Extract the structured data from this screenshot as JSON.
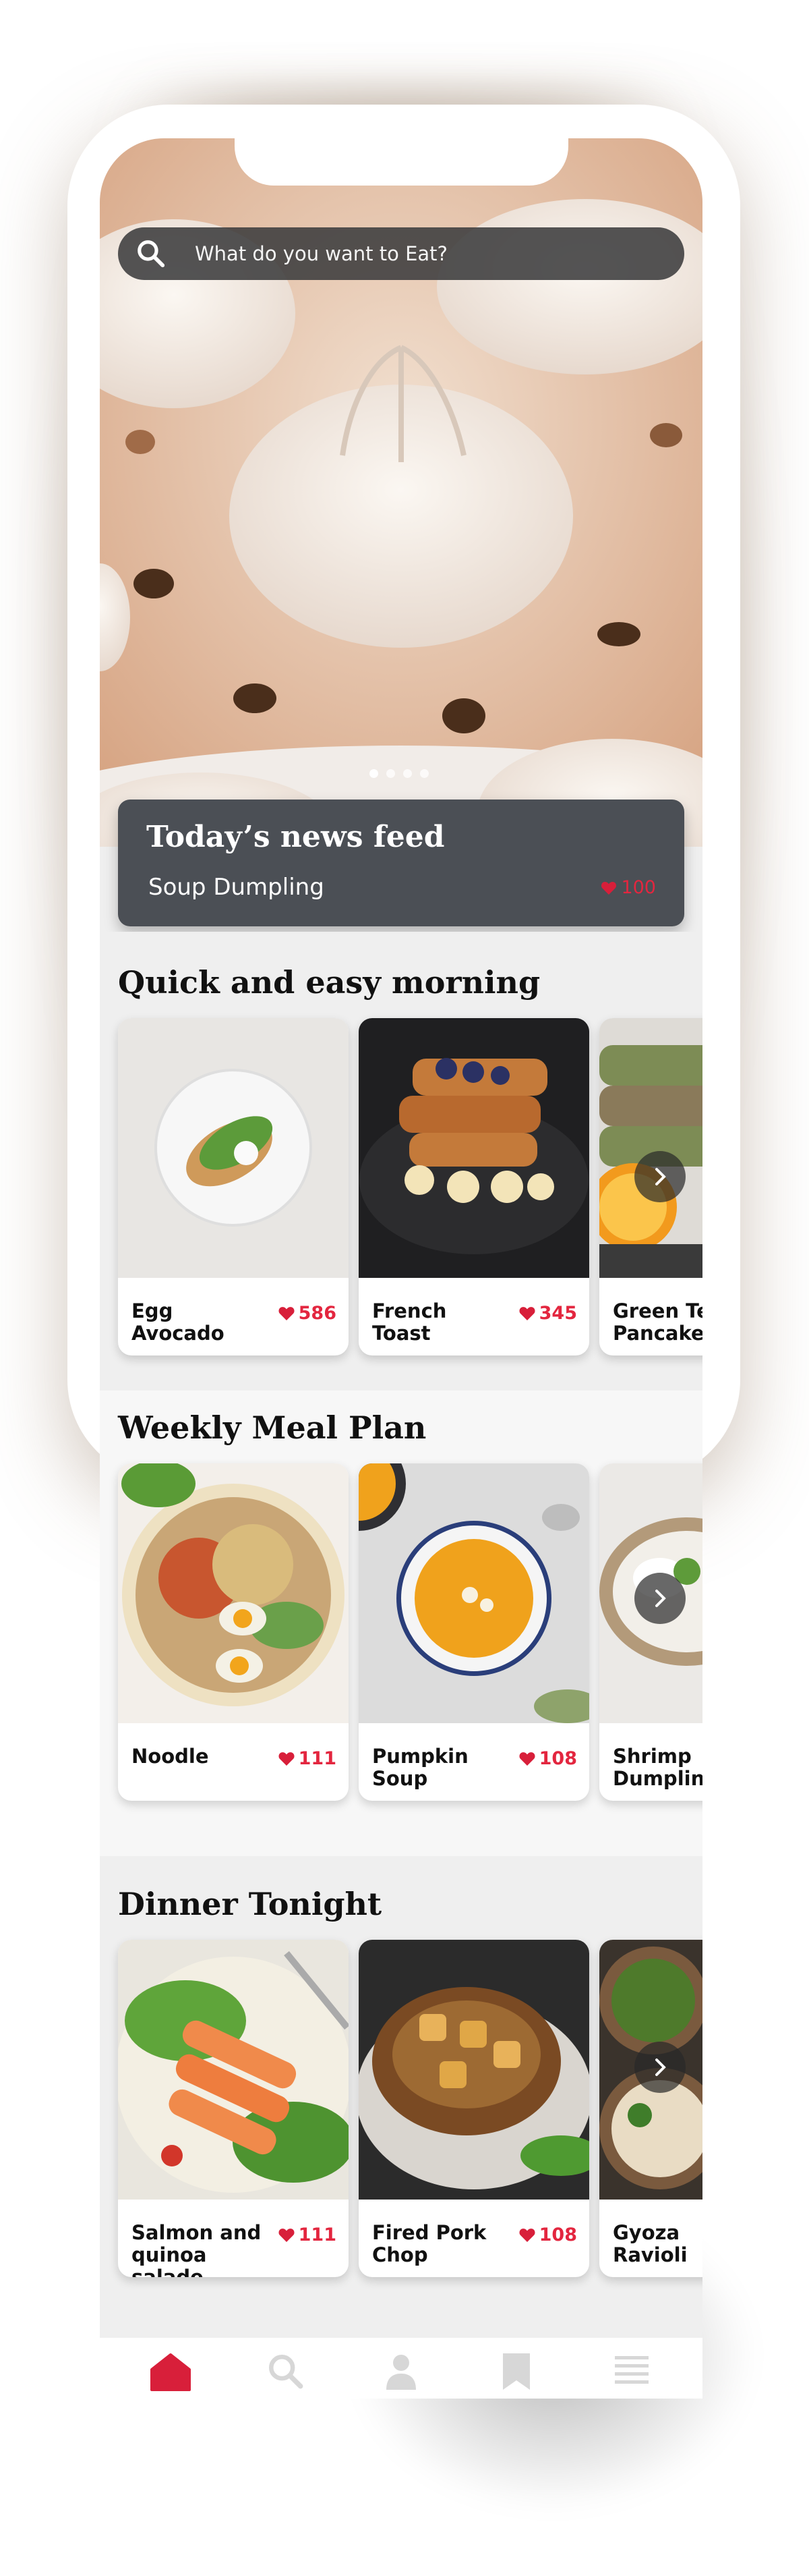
{
  "search": {
    "placeholder": "What do you want to Eat?"
  },
  "hero": {
    "dots": 4,
    "active_dot": 0
  },
  "news": {
    "title": "Today’s news feed",
    "subtitle": "Soup Dumpling",
    "likes": "100"
  },
  "sections": [
    {
      "title": "Quick and easy morning",
      "cards": [
        {
          "name": "Egg Avocado",
          "likes": "586"
        },
        {
          "name": "French Toast",
          "likes": "345"
        },
        {
          "name": "Green Tea Pancake",
          "likes": ""
        }
      ]
    },
    {
      "title": "Weekly Meal Plan",
      "cards": [
        {
          "name": "Noodle",
          "likes": "111"
        },
        {
          "name": "Pumpkin Soup",
          "likes": "108"
        },
        {
          "name": "Shrimp Dumpling",
          "likes": ""
        }
      ]
    },
    {
      "title": "Dinner Tonight",
      "cards": [
        {
          "name": "Salmon and quinoa salade",
          "likes": "111"
        },
        {
          "name": "Fired Pork Chop",
          "likes": "108"
        },
        {
          "name": "Gyoza Ravioli",
          "likes": ""
        }
      ]
    }
  ],
  "nav": [
    "home-icon",
    "search-icon",
    "profile-icon",
    "bookmark-icon",
    "menu-icon"
  ],
  "colors": {
    "accent": "#d81f3a",
    "card_dark": "#4b4f55",
    "nav_inactive": "#d7d7d7"
  }
}
